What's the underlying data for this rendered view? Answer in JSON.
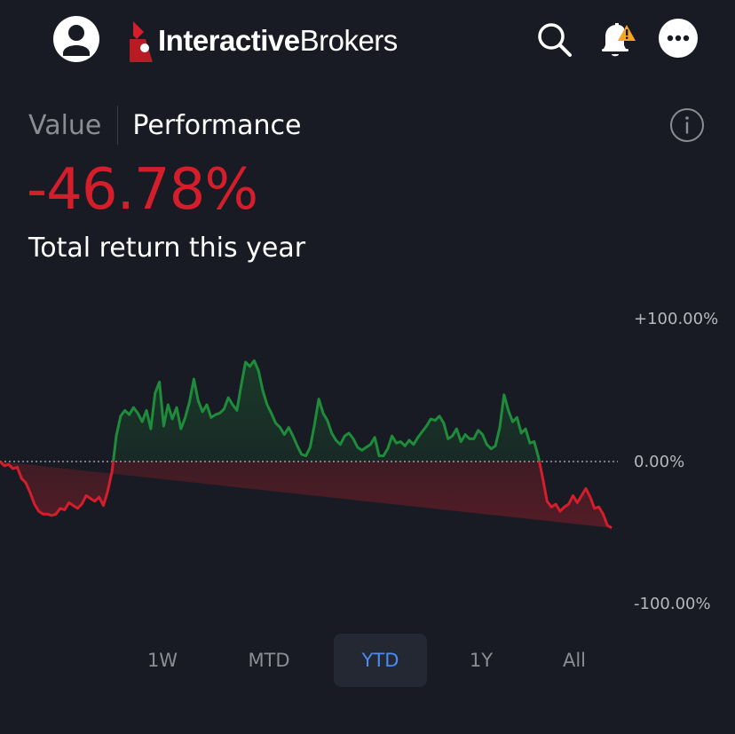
{
  "header": {
    "logo_bold": "Interactive",
    "logo_light": "Brokers",
    "icons": [
      "user-avatar-icon",
      "search-icon",
      "bell-alert-icon",
      "more-icon"
    ]
  },
  "tabs": {
    "value_label": "Value",
    "performance_label": "Performance"
  },
  "performance": {
    "value": "-46.78%",
    "label": "Total return this year"
  },
  "colors": {
    "negative": "#d41e2c",
    "positive": "#1e8c3a",
    "active_range": "#4a8cf0",
    "background": "#181b23"
  },
  "ranges": {
    "items": [
      "1W",
      "MTD",
      "YTD",
      "1Y",
      "All"
    ],
    "selected": "YTD"
  },
  "chart_data": {
    "type": "line",
    "y_ticks": [
      "+100.00%",
      "0.00%",
      "-100.00%"
    ],
    "ylim": [
      -100,
      100
    ],
    "baseline": 0,
    "x": [
      0,
      1,
      2,
      3,
      4,
      5,
      6,
      7,
      8,
      9,
      10,
      11,
      12,
      13,
      14,
      15,
      16,
      17,
      18,
      19,
      20,
      21,
      22,
      23,
      24,
      25,
      26,
      27,
      28,
      29,
      30,
      31,
      32,
      33,
      34,
      35,
      36,
      37,
      38,
      39,
      40,
      41,
      42,
      43,
      44,
      45,
      46,
      47,
      48,
      49,
      50,
      51,
      52,
      53,
      54,
      55,
      56,
      57,
      58,
      59,
      60,
      61,
      62,
      63,
      64,
      65,
      66,
      67,
      68,
      69,
      70,
      71,
      72,
      73,
      74,
      75,
      76,
      77,
      78,
      79,
      80,
      81,
      82,
      83,
      84,
      85,
      86,
      87,
      88,
      89,
      90,
      91,
      92,
      93,
      94,
      95,
      96,
      97,
      98,
      99,
      100,
      101,
      102,
      103,
      104,
      105,
      106,
      107,
      108,
      109,
      110,
      111,
      112,
      113,
      114,
      115,
      116,
      117,
      118,
      119,
      120,
      121,
      122,
      123,
      124,
      125,
      126,
      127,
      128,
      129,
      130,
      131,
      132,
      133,
      134,
      135,
      136,
      137,
      138,
      139,
      140,
      141,
      142,
      143
    ],
    "values": [
      0,
      -3,
      -2,
      -5,
      -4,
      -12,
      -15,
      -22,
      -30,
      -35,
      -37,
      -37,
      -38,
      -37,
      -33,
      -34,
      -29,
      -31,
      -33,
      -30,
      -24,
      -26,
      -28,
      -25,
      -31,
      -21,
      -7,
      18,
      32,
      36,
      33,
      38,
      34,
      28,
      36,
      23,
      48,
      56,
      25,
      40,
      30,
      38,
      23,
      31,
      42,
      58,
      43,
      35,
      40,
      31,
      33,
      34,
      37,
      45,
      40,
      36,
      54,
      70,
      67,
      71,
      64,
      50,
      40,
      34,
      27,
      24,
      19,
      24,
      18,
      11,
      5,
      4,
      10,
      26,
      44,
      34,
      29,
      20,
      15,
      12,
      18,
      20,
      16,
      10,
      8,
      10,
      12,
      17,
      4,
      4,
      9,
      18,
      13,
      14,
      11,
      15,
      12,
      17,
      21,
      25,
      30,
      29,
      32,
      27,
      16,
      18,
      23,
      14,
      19,
      16,
      16,
      22,
      19,
      12,
      9,
      11,
      24,
      47,
      36,
      28,
      31,
      20,
      23,
      13,
      14,
      3,
      -12,
      -28,
      -32,
      -30,
      -35,
      -32,
      -30,
      -24,
      -29,
      -24,
      -19,
      -25,
      -33,
      -32,
      -37,
      -45,
      -46.78
    ]
  }
}
